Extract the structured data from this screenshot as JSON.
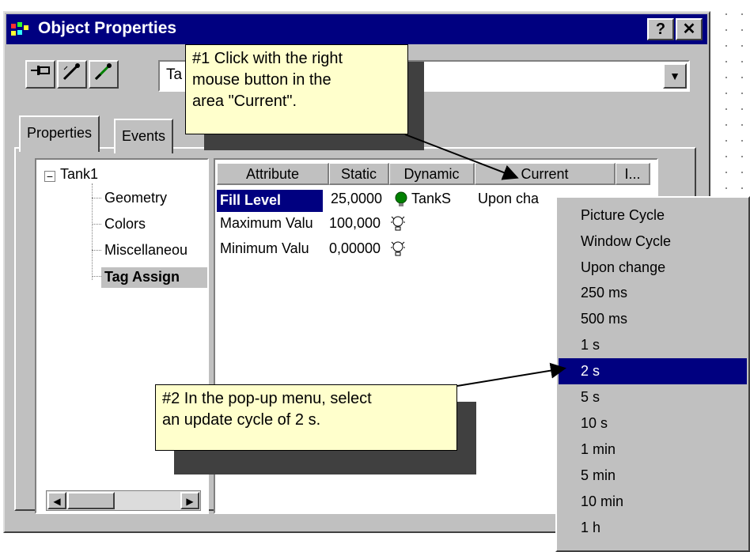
{
  "window": {
    "title": "Object Properties",
    "help_label": "?",
    "close_label": "✕"
  },
  "toolbar": {
    "combo_value": "Ta"
  },
  "tabs": [
    "Properties",
    "Events"
  ],
  "tree": {
    "root": "Tank1",
    "children": [
      "Geometry",
      "Colors",
      "Miscellaneou",
      "Tag Assign"
    ]
  },
  "grid": {
    "headers": [
      "Attribute",
      "Static",
      "Dynamic",
      "Current",
      "I..."
    ],
    "rows": [
      {
        "attribute": "Fill Level",
        "static": "25,0000",
        "dynamic": "TankS",
        "current": "Upon cha"
      },
      {
        "attribute": "Maximum Valu",
        "static": "100,000",
        "dynamic": "",
        "current": ""
      },
      {
        "attribute": "Minimum Valu",
        "static": "0,00000",
        "dynamic": "",
        "current": ""
      }
    ]
  },
  "callouts": {
    "one": [
      "#1 Click with the right",
      "mouse button in the",
      "area \"Current\"."
    ],
    "two": [
      "#2 In the pop-up menu, select",
      "an update cycle of 2 s."
    ]
  },
  "menu": {
    "items": [
      "Picture Cycle",
      "Window Cycle",
      "Upon change",
      "250 ms",
      "500 ms",
      "1 s",
      "2 s",
      "5 s",
      "10 s",
      "1 min",
      "5 min",
      "10 min",
      "1 h"
    ],
    "selected": "2 s"
  },
  "colors": {
    "titlebar": "#000080",
    "callout": "#ffffcc",
    "selection": "#000080",
    "bulb_active": "#008000"
  }
}
